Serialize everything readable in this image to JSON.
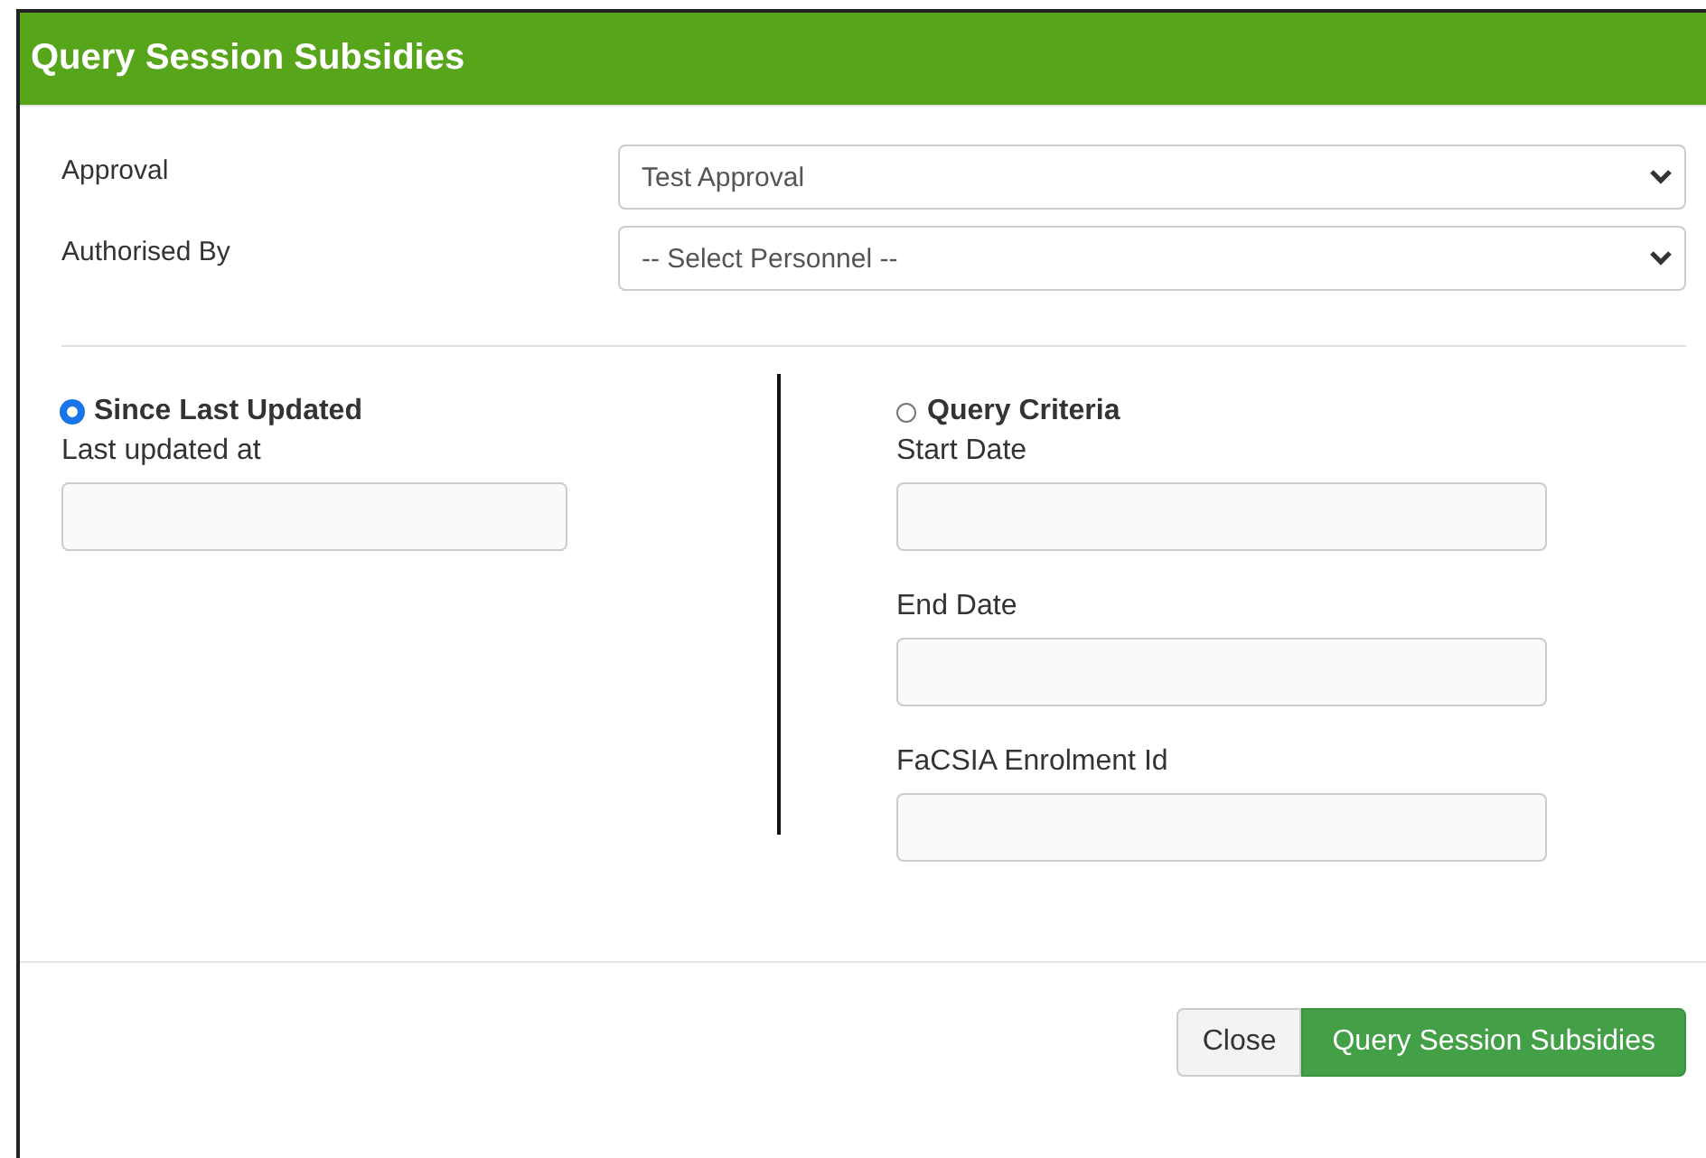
{
  "dialog": {
    "title": "Query Session Subsidies"
  },
  "selects": [
    {
      "label": "Approval",
      "value": "Test Approval"
    },
    {
      "label": "Authorised By",
      "value": "-- Select Personnel --"
    }
  ],
  "modes": [
    {
      "label": "Since Last Updated",
      "selected": true,
      "fields": [
        {
          "label": "Last updated at"
        }
      ]
    },
    {
      "label": "Query Criteria",
      "selected": false,
      "fields": [
        {
          "label": "Start Date"
        },
        {
          "label": "End Date"
        },
        {
          "label": "FaCSIA Enrolment Id"
        }
      ]
    }
  ],
  "buttons": [
    {
      "label": "Close",
      "kind": "secondary"
    },
    {
      "label": "Query Session Subsidies",
      "kind": "primary"
    }
  ]
}
